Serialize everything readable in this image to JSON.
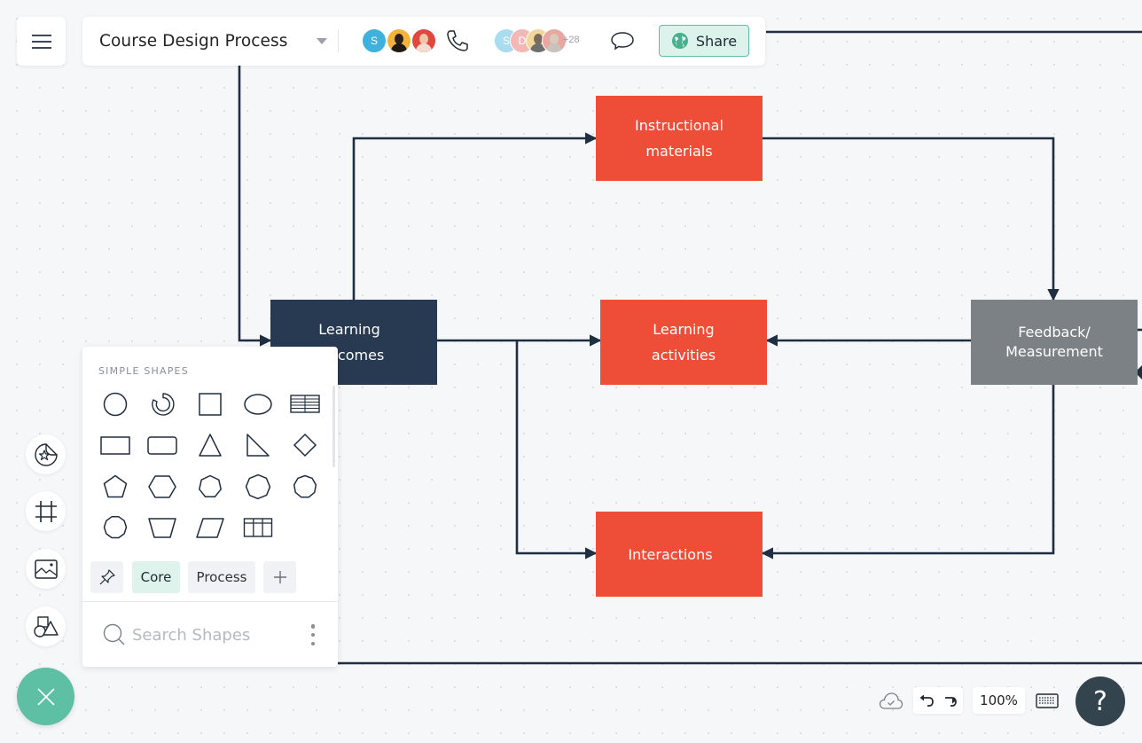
{
  "header": {
    "document_title": "Course Design Process",
    "share_label": "Share",
    "collaborators_active": [
      {
        "initial": "S",
        "color": "#3eb1dd",
        "kind": "initial"
      },
      {
        "initial": "",
        "color": "#f4b43a",
        "kind": "photo"
      },
      {
        "initial": "",
        "color": "#e0473e",
        "kind": "photo"
      }
    ],
    "collaborators_viewing": [
      {
        "initial": "S",
        "color": "#a9dcef",
        "kind": "initial"
      },
      {
        "initial": "D",
        "color": "#f3b7b5",
        "kind": "initial"
      },
      {
        "initial": "",
        "color": "#f2d79b",
        "kind": "photo"
      },
      {
        "initial": "",
        "color": "#e9a7a3",
        "kind": "photo"
      }
    ],
    "more_collaborators": "+28",
    "icons": {
      "menu": "hamburger-icon",
      "dropdown": "caret-down-icon",
      "call": "phone-icon",
      "comment": "comment-bubble-icon",
      "share": "globe-icon"
    }
  },
  "diagram": {
    "nodes": [
      {
        "id": "instructional-materials",
        "label": "Instructional\nmaterials",
        "style": "orange"
      },
      {
        "id": "learning-outcomes",
        "label": "Learning\noutcomes",
        "style": "navy"
      },
      {
        "id": "learning-activities",
        "label": "Learning\nactivities",
        "style": "orange"
      },
      {
        "id": "feedback-measurement",
        "label": "Feedback/\nMeasurement",
        "style": "gray"
      },
      {
        "id": "interactions",
        "label": "Interactions",
        "style": "orange"
      }
    ],
    "colors": {
      "orange": "#ee4d37",
      "navy": "#273a51",
      "gray": "#7b8185",
      "connector": "#1f2e40"
    }
  },
  "left_rail": {
    "buttons": [
      {
        "name": "sticker-icon",
        "label": "Stickers"
      },
      {
        "name": "frame-icon",
        "label": "Frames"
      },
      {
        "name": "image-icon",
        "label": "Images"
      },
      {
        "name": "shapes-icon",
        "label": "Shapes"
      }
    ],
    "fab_icon": "close-icon"
  },
  "shapes_panel": {
    "section_title": "SIMPLE SHAPES",
    "shapes": [
      "circle",
      "partial-ring",
      "square",
      "ellipse",
      "striped-table",
      "rectangle",
      "rounded-rectangle",
      "triangle",
      "right-triangle",
      "diamond",
      "pentagon",
      "hexagon",
      "heptagon",
      "octagon",
      "nonagon",
      "decagon",
      "trapezoid",
      "parallelogram",
      "grid-table"
    ],
    "tags": [
      {
        "label": "",
        "icon": "pin-icon",
        "active": false
      },
      {
        "label": "Core",
        "active": true
      },
      {
        "label": "Process",
        "active": false
      },
      {
        "label": "",
        "icon": "plus-icon",
        "active": false
      }
    ],
    "search_placeholder": "Search Shapes"
  },
  "bottom_bar": {
    "zoom_level": "100%",
    "help_label": "?",
    "icons": {
      "sync": "cloud-check-icon",
      "undo": "undo-icon",
      "redo": "redo-icon",
      "keyboard": "keyboard-icon"
    },
    "accent": "#5dbfa4"
  }
}
